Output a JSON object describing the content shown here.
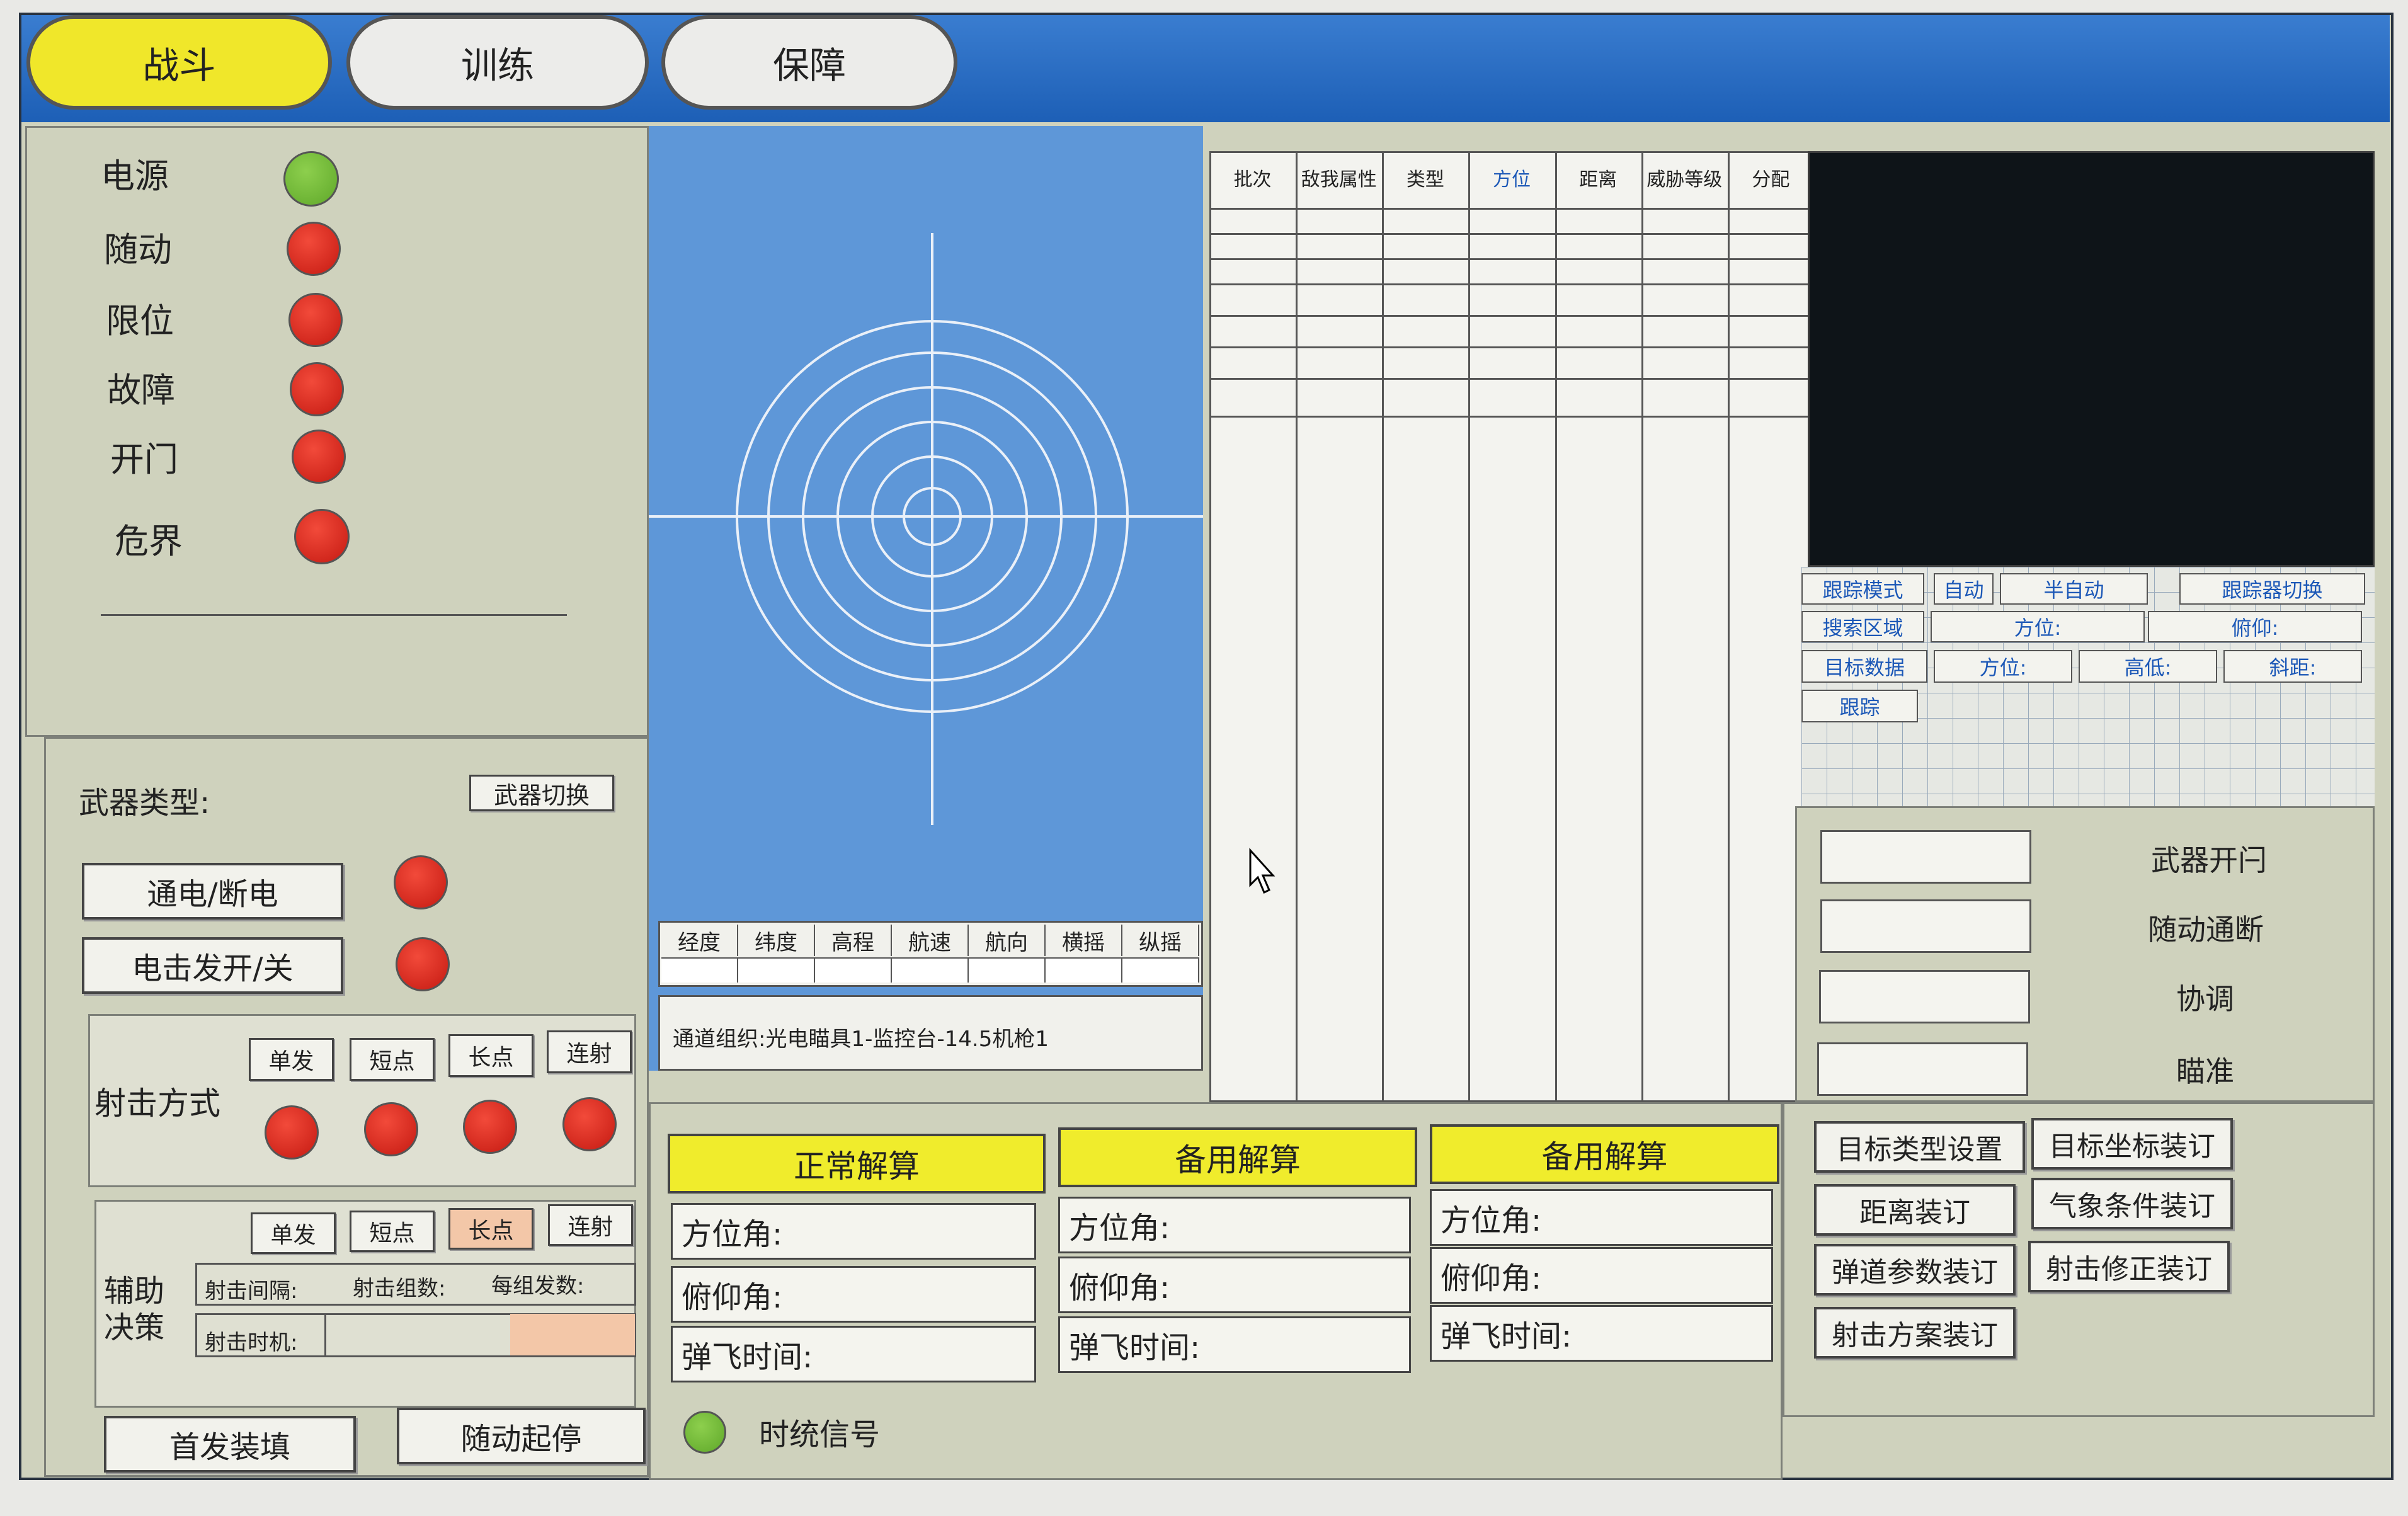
{
  "tabs": [
    "战斗",
    "训练",
    "保障"
  ],
  "status_panel": {
    "items": [
      {
        "label": "电源",
        "state": "green"
      },
      {
        "label": "随动",
        "state": "red"
      },
      {
        "label": "限位",
        "state": "red"
      },
      {
        "label": "故障",
        "state": "red"
      },
      {
        "label": "开门",
        "state": "red"
      },
      {
        "label": "危界",
        "state": "red"
      }
    ]
  },
  "weapon": {
    "type_label": "武器类型:",
    "switch_button": "武器切换",
    "power_button": "通电/断电",
    "fire_button": "电击发开/关"
  },
  "fire_mode": {
    "label": "射击方式",
    "options": [
      "单发",
      "短点",
      "长点",
      "连射"
    ]
  },
  "aux": {
    "label_line1": "辅助",
    "label_line2": "决策",
    "options": [
      "单发",
      "短点",
      "长点",
      "连射"
    ],
    "selected": "长点",
    "interval_label": "射击间隔:",
    "group_count_label": "射击组数:",
    "per_group_label": "每组发数:",
    "timing_label": "射击时机:"
  },
  "bottom_buttons": [
    "首发装填",
    "随动起停"
  ],
  "nav_columns": [
    "经度",
    "纬度",
    "高程",
    "航速",
    "航向",
    "横摇",
    "纵摇"
  ],
  "channel_text": "通道组织:光电瞄具1-监控台-14.5机枪1",
  "target_table": {
    "headers": [
      "批次",
      "敌我属性",
      "类型",
      "方位",
      "距离",
      "威胁等级",
      "分配"
    ]
  },
  "tracker": {
    "mode_label": "跟踪模式",
    "mode_auto": "自动",
    "mode_semi": "半自动",
    "switch_label": "跟踪器切换",
    "search_label": "搜索区域",
    "azimuth_label": "方位:",
    "pitch_label": "俯仰:",
    "target_data_label": "目标数据",
    "height_label": "高低:",
    "slant_label": "斜距:",
    "track_label": "跟踪"
  },
  "weapon_status": {
    "items": [
      "武器开闩",
      "随动通断",
      "协调",
      "瞄准"
    ]
  },
  "solutions": [
    {
      "title": "正常解算",
      "fields": [
        "方位角:",
        "俯仰角:",
        "弹飞时间:"
      ]
    },
    {
      "title": "备用解算",
      "fields": [
        "方位角:",
        "俯仰角:",
        "弹飞时间:"
      ]
    },
    {
      "title": "备用解算",
      "fields": [
        "方位角:",
        "俯仰角:",
        "弹飞时间:"
      ]
    }
  ],
  "time_signal": "时统信号",
  "binding_buttons": [
    "目标类型设置",
    "目标坐标装订",
    "距离装订",
    "气象条件装订",
    "弹道参数装订",
    "射击修正装订",
    "射击方案装订"
  ],
  "colors": {
    "accent_blue": "#1d5fb6",
    "active_tab": "#f0e72a",
    "lamp_red": "#d4241a",
    "lamp_green": "#7cbf3f",
    "highlight": "#f3c7a8"
  }
}
